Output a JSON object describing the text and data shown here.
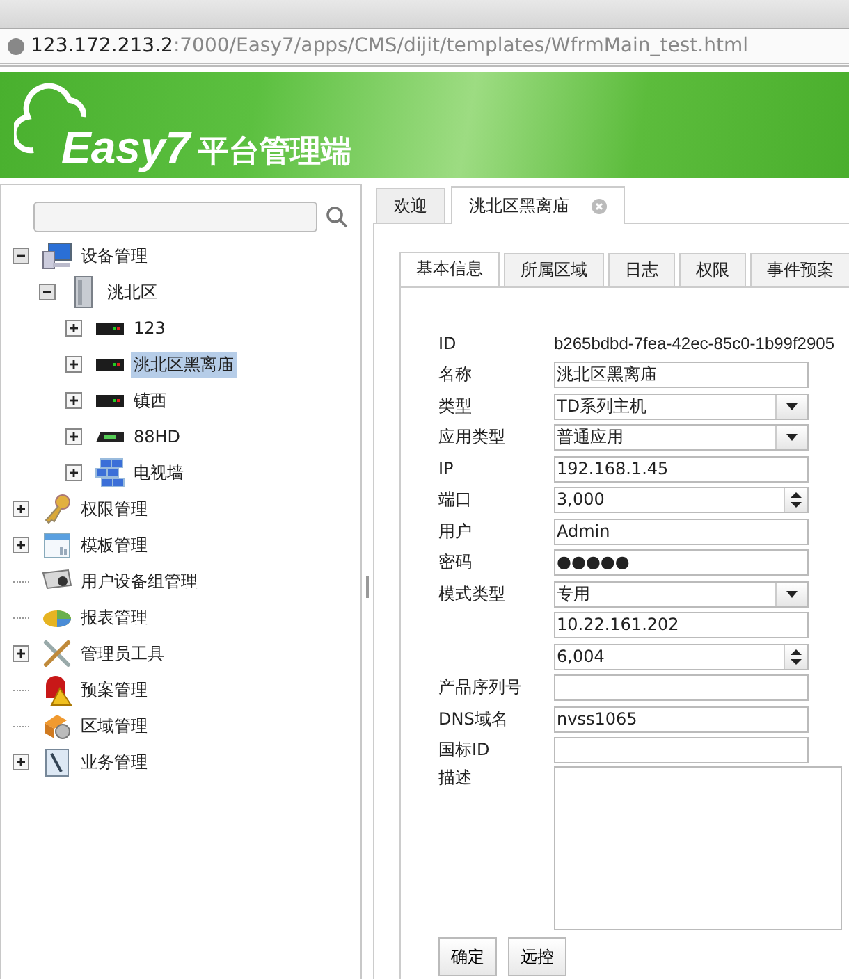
{
  "address_bar": {
    "host": "123.172.213.2",
    "path": ":7000/Easy7/apps/CMS/dijit/templates/WfrmMain_test.html"
  },
  "banner": {
    "logo": "Easy7",
    "title": "平台管理端"
  },
  "tree": [
    {
      "label": "设备管理",
      "kind": "computer",
      "expandable": true,
      "expanded": true,
      "selected": false,
      "children": [
        {
          "label": "洮北区",
          "kind": "server",
          "expandable": true,
          "expanded": true,
          "selected": false,
          "children": [
            {
              "label": "123",
              "kind": "dvr",
              "expandable": true,
              "expanded": false,
              "selected": false
            },
            {
              "label": "洮北区黑离庙",
              "kind": "dvr",
              "expandable": true,
              "expanded": false,
              "selected": true
            },
            {
              "label": "镇西",
              "kind": "dvr",
              "expandable": true,
              "expanded": false,
              "selected": false
            },
            {
              "label": "88HD",
              "kind": "encoder",
              "expandable": true,
              "expanded": false,
              "selected": false
            },
            {
              "label": "电视墙",
              "kind": "videowall",
              "expandable": true,
              "expanded": false,
              "selected": false
            }
          ]
        }
      ]
    },
    {
      "label": "权限管理",
      "kind": "key",
      "expandable": true,
      "expanded": false,
      "selected": false
    },
    {
      "label": "模板管理",
      "kind": "calendar",
      "expandable": true,
      "expanded": false,
      "selected": false
    },
    {
      "label": "用户设备组管理",
      "kind": "camera",
      "selected": false
    },
    {
      "label": "报表管理",
      "kind": "pie",
      "selected": false
    },
    {
      "label": "管理员工具",
      "kind": "tools",
      "expandable": true,
      "expanded": false,
      "selected": false
    },
    {
      "label": "预案管理",
      "kind": "alarm",
      "selected": false
    },
    {
      "label": "区域管理",
      "kind": "boxgear",
      "selected": false
    },
    {
      "label": "业务管理",
      "kind": "document",
      "expandable": true,
      "expanded": false,
      "selected": false
    }
  ],
  "tabs": [
    {
      "label": "欢迎",
      "selected": false,
      "closable": false
    },
    {
      "label": "洮北区黑离庙",
      "selected": true,
      "closable": true
    }
  ],
  "detail_tabs": [
    {
      "label": "基本信息",
      "selected": true
    },
    {
      "label": "所属区域",
      "selected": false
    },
    {
      "label": "日志",
      "selected": false
    },
    {
      "label": "权限",
      "selected": false
    },
    {
      "label": "事件预案",
      "selected": false
    }
  ],
  "form": [
    {
      "label": "ID",
      "kind": "text",
      "value": "b265bdbd-7fea-42ec-85c0-1b99f2905"
    },
    {
      "label": "名称",
      "kind": "input",
      "value": "洮北区黑离庙"
    },
    {
      "label": "类型",
      "kind": "select",
      "value": "TD系列主机"
    },
    {
      "label": "应用类型",
      "kind": "select",
      "value": "普通应用"
    },
    {
      "label": "IP",
      "kind": "input",
      "value": "192.168.1.45"
    },
    {
      "label": "端口",
      "kind": "spinner",
      "value": "3,000"
    },
    {
      "label": "用户",
      "kind": "input",
      "value": "Admin"
    },
    {
      "label": "密码",
      "kind": "input",
      "value": "●●●●●"
    },
    {
      "label": "模式类型",
      "kind": "select",
      "value": "专用"
    },
    {
      "kind": "input",
      "value": "10.22.161.202"
    },
    {
      "kind": "spinner",
      "value": "6,004"
    },
    {
      "label": "产品序列号",
      "kind": "input"
    },
    {
      "label": "DNS域名",
      "kind": "input",
      "value": "nvss1065"
    },
    {
      "label": "国标ID",
      "kind": "input"
    },
    {
      "label": "描述",
      "kind": "textarea"
    }
  ],
  "buttons": [
    "确定",
    "远控"
  ]
}
